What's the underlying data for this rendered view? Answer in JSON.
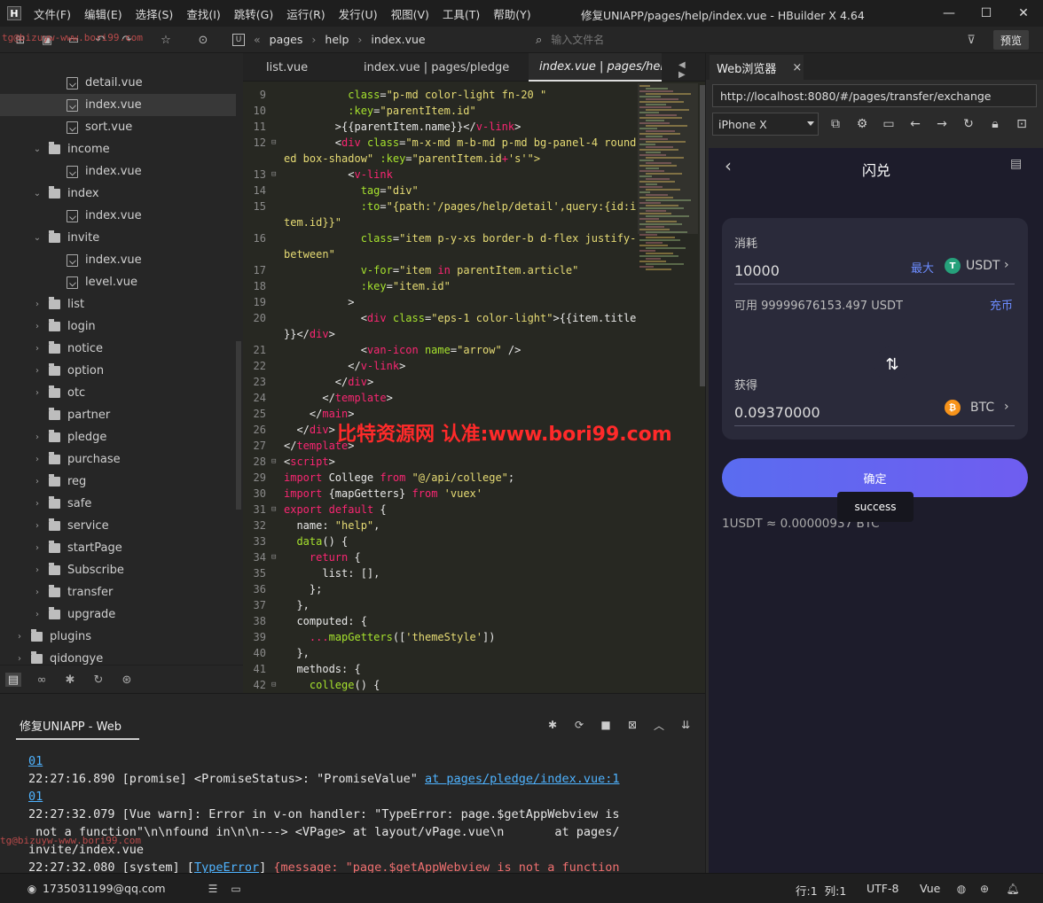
{
  "window": {
    "app_icon": "H",
    "title": "修复UNIAPP/pages/help/index.vue - HBuilder X 4.64",
    "menus": [
      "文件(F)",
      "编辑(E)",
      "选择(S)",
      "查找(I)",
      "跳转(G)",
      "运行(R)",
      "发行(U)",
      "视图(V)",
      "工具(T)",
      "帮助(Y)"
    ]
  },
  "toolbar": {
    "crumbs": [
      "pages",
      "help",
      "index.vue"
    ],
    "crumb_sep": "›",
    "file_search_placeholder": "输入文件名",
    "preview_label": "预览"
  },
  "watermarks": {
    "main": "比特资源网 认准:www.bori99.com",
    "small_top": "tg@bizuyw-www.bori99.com",
    "small_bottom": "tg@bizuyw-www.bori99.com"
  },
  "sidebar": {
    "items": [
      {
        "label": "detail.vue",
        "kind": "file",
        "depth": 3,
        "chevron": ""
      },
      {
        "label": "index.vue",
        "kind": "file",
        "depth": 3,
        "chevron": "",
        "selected": true
      },
      {
        "label": "sort.vue",
        "kind": "file",
        "depth": 3,
        "chevron": ""
      },
      {
        "label": "income",
        "kind": "folder",
        "depth": 2,
        "chevron": "⌄"
      },
      {
        "label": "index.vue",
        "kind": "file",
        "depth": 3,
        "chevron": ""
      },
      {
        "label": "index",
        "kind": "folder",
        "depth": 2,
        "chevron": "⌄"
      },
      {
        "label": "index.vue",
        "kind": "file",
        "depth": 3,
        "chevron": ""
      },
      {
        "label": "invite",
        "kind": "folder",
        "depth": 2,
        "chevron": "⌄"
      },
      {
        "label": "index.vue",
        "kind": "file",
        "depth": 3,
        "chevron": ""
      },
      {
        "label": "level.vue",
        "kind": "file",
        "depth": 3,
        "chevron": ""
      },
      {
        "label": "list",
        "kind": "folder",
        "depth": 2,
        "chevron": "›"
      },
      {
        "label": "login",
        "kind": "folder",
        "depth": 2,
        "chevron": "›"
      },
      {
        "label": "notice",
        "kind": "folder",
        "depth": 2,
        "chevron": "›"
      },
      {
        "label": "option",
        "kind": "folder",
        "depth": 2,
        "chevron": "›"
      },
      {
        "label": "otc",
        "kind": "folder",
        "depth": 2,
        "chevron": "›"
      },
      {
        "label": "partner",
        "kind": "folder",
        "depth": 2,
        "chevron": ""
      },
      {
        "label": "pledge",
        "kind": "folder",
        "depth": 2,
        "chevron": "›"
      },
      {
        "label": "purchase",
        "kind": "folder",
        "depth": 2,
        "chevron": "›"
      },
      {
        "label": "reg",
        "kind": "folder",
        "depth": 2,
        "chevron": "›"
      },
      {
        "label": "safe",
        "kind": "folder",
        "depth": 2,
        "chevron": "›"
      },
      {
        "label": "service",
        "kind": "folder",
        "depth": 2,
        "chevron": "›"
      },
      {
        "label": "startPage",
        "kind": "folder",
        "depth": 2,
        "chevron": "›"
      },
      {
        "label": "Subscribe",
        "kind": "folder",
        "depth": 2,
        "chevron": "›"
      },
      {
        "label": "transfer",
        "kind": "folder",
        "depth": 2,
        "chevron": "›"
      },
      {
        "label": "upgrade",
        "kind": "folder",
        "depth": 2,
        "chevron": "›"
      },
      {
        "label": "plugins",
        "kind": "folder",
        "depth": 1,
        "chevron": "›"
      },
      {
        "label": "qidongye",
        "kind": "folder",
        "depth": 1,
        "chevron": "›"
      }
    ]
  },
  "editor": {
    "tabs": [
      "list.vue",
      "index.vue | pages/pledge",
      "index.vue | pages/help"
    ],
    "tab_nav": "◀ ▶",
    "lines": [
      {
        "n": "9",
        "fold": "",
        "s": [
          [
            "          ",
            "p"
          ],
          [
            "class",
            "a"
          ],
          [
            "=",
            "p"
          ],
          [
            "\"p-md color-light fn-20 \"",
            "s"
          ]
        ]
      },
      {
        "n": "10",
        "fold": "",
        "s": [
          [
            "          ",
            "p"
          ],
          [
            ":key",
            "a"
          ],
          [
            "=",
            "p"
          ],
          [
            "\"parentItem.id\"",
            "s"
          ]
        ]
      },
      {
        "n": "11",
        "fold": "",
        "s": [
          [
            "        >{{parentItem.name}}</",
            "p"
          ],
          [
            "v-link",
            "t"
          ],
          [
            ">",
            "p"
          ]
        ]
      },
      {
        "n": "12",
        "fold": "⊟",
        "s": [
          [
            "        <",
            "p"
          ],
          [
            "div",
            "t"
          ],
          [
            " ",
            "p"
          ],
          [
            "class",
            "a"
          ],
          [
            "=",
            "p"
          ],
          [
            "\"m-x-md m-b-md p-md bg-panel-4 round",
            "s"
          ]
        ]
      },
      {
        "n": "",
        "fold": "",
        "s": [
          [
            "ed box-shadow\"",
            "s"
          ],
          [
            " ",
            "p"
          ],
          [
            ":key",
            "a"
          ],
          [
            "=",
            "p"
          ],
          [
            "\"parentItem.id",
            "s"
          ],
          [
            "+",
            "t"
          ],
          [
            "'s'",
            "s"
          ],
          [
            "\">",
            "s"
          ]
        ]
      },
      {
        "n": "13",
        "fold": "⊟",
        "s": [
          [
            "          <",
            "p"
          ],
          [
            "v-link",
            "t"
          ]
        ]
      },
      {
        "n": "14",
        "fold": "",
        "s": [
          [
            "            ",
            "p"
          ],
          [
            "tag",
            "a"
          ],
          [
            "=",
            "p"
          ],
          [
            "\"div\"",
            "s"
          ]
        ]
      },
      {
        "n": "15",
        "fold": "",
        "s": [
          [
            "            ",
            "p"
          ],
          [
            ":to",
            "a"
          ],
          [
            "=",
            "p"
          ],
          [
            "\"{path:'/pages/help/detail',query:{id:i",
            "s"
          ]
        ]
      },
      {
        "n": "",
        "fold": "",
        "s": [
          [
            "tem.id}}\"",
            "s"
          ]
        ]
      },
      {
        "n": "16",
        "fold": "",
        "s": [
          [
            "            ",
            "p"
          ],
          [
            "class",
            "a"
          ],
          [
            "=",
            "p"
          ],
          [
            "\"item p-y-xs border-b d-flex justify-",
            "s"
          ]
        ]
      },
      {
        "n": "",
        "fold": "",
        "s": [
          [
            "between\"",
            "s"
          ]
        ]
      },
      {
        "n": "17",
        "fold": "",
        "s": [
          [
            "            ",
            "p"
          ],
          [
            "v-for",
            "a"
          ],
          [
            "=",
            "p"
          ],
          [
            "\"item ",
            "s"
          ],
          [
            "in",
            "t"
          ],
          [
            " parentItem.article\"",
            "s"
          ]
        ]
      },
      {
        "n": "18",
        "fold": "",
        "s": [
          [
            "            ",
            "p"
          ],
          [
            ":key",
            "a"
          ],
          [
            "=",
            "p"
          ],
          [
            "\"item.id\"",
            "s"
          ]
        ]
      },
      {
        "n": "19",
        "fold": "",
        "s": [
          [
            "          >",
            "p"
          ]
        ]
      },
      {
        "n": "20",
        "fold": "",
        "s": [
          [
            "            <",
            "p"
          ],
          [
            "div",
            "t"
          ],
          [
            " ",
            "p"
          ],
          [
            "class",
            "a"
          ],
          [
            "=",
            "p"
          ],
          [
            "\"eps-1 color-light\"",
            "s"
          ],
          [
            ">{{item.title",
            "p"
          ]
        ]
      },
      {
        "n": "",
        "fold": "",
        "s": [
          [
            "}}</",
            "p"
          ],
          [
            "div",
            "t"
          ],
          [
            ">",
            "p"
          ]
        ]
      },
      {
        "n": "21",
        "fold": "",
        "s": [
          [
            "            <",
            "p"
          ],
          [
            "van-icon",
            "t"
          ],
          [
            " ",
            "p"
          ],
          [
            "name",
            "a"
          ],
          [
            "=",
            "p"
          ],
          [
            "\"arrow\"",
            "s"
          ],
          [
            " />",
            "p"
          ]
        ]
      },
      {
        "n": "22",
        "fold": "",
        "s": [
          [
            "          </",
            "p"
          ],
          [
            "v-link",
            "t"
          ],
          [
            ">",
            "p"
          ]
        ]
      },
      {
        "n": "23",
        "fold": "",
        "s": [
          [
            "        </",
            "p"
          ],
          [
            "div",
            "t"
          ],
          [
            ">",
            "p"
          ]
        ]
      },
      {
        "n": "24",
        "fold": "",
        "s": [
          [
            "      </",
            "p"
          ],
          [
            "template",
            "t"
          ],
          [
            ">",
            "p"
          ]
        ]
      },
      {
        "n": "25",
        "fold": "",
        "s": [
          [
            "    </",
            "p"
          ],
          [
            "main",
            "t"
          ],
          [
            ">",
            "p"
          ]
        ]
      },
      {
        "n": "26",
        "fold": "",
        "s": [
          [
            "  </",
            "p"
          ],
          [
            "div",
            "t"
          ],
          [
            ">",
            "p"
          ]
        ]
      },
      {
        "n": "27",
        "fold": "",
        "s": [
          [
            "</",
            "p"
          ],
          [
            "template",
            "t"
          ],
          [
            ">",
            "p"
          ]
        ]
      },
      {
        "n": "28",
        "fold": "⊟",
        "s": [
          [
            "<",
            "p"
          ],
          [
            "script",
            "t"
          ],
          [
            ">",
            "p"
          ]
        ]
      },
      {
        "n": "29",
        "fold": "",
        "s": [
          [
            "import",
            "t"
          ],
          [
            " College ",
            "p"
          ],
          [
            "from",
            "t"
          ],
          [
            " ",
            "p"
          ],
          [
            "\"@/api/college\"",
            "s"
          ],
          [
            ";",
            "p"
          ]
        ]
      },
      {
        "n": "30",
        "fold": "",
        "s": [
          [
            "import",
            "t"
          ],
          [
            " {mapGetters} ",
            "p"
          ],
          [
            "from",
            "t"
          ],
          [
            " ",
            "p"
          ],
          [
            "'vuex'",
            "s"
          ]
        ]
      },
      {
        "n": "31",
        "fold": "⊟",
        "s": [
          [
            "export",
            "t"
          ],
          [
            " ",
            "p"
          ],
          [
            "default",
            "t"
          ],
          [
            " {",
            "p"
          ]
        ]
      },
      {
        "n": "32",
        "fold": "",
        "s": [
          [
            "  name: ",
            "p"
          ],
          [
            "\"help\"",
            "s"
          ],
          [
            ",",
            "p"
          ]
        ]
      },
      {
        "n": "33",
        "fold": "",
        "s": [
          [
            "  ",
            "p"
          ],
          [
            "data",
            "a"
          ],
          [
            "() {",
            "p"
          ]
        ]
      },
      {
        "n": "34",
        "fold": "⊟",
        "s": [
          [
            "    ",
            "p"
          ],
          [
            "return",
            "t"
          ],
          [
            " {",
            "p"
          ]
        ]
      },
      {
        "n": "35",
        "fold": "",
        "s": [
          [
            "      list: [],",
            "p"
          ]
        ]
      },
      {
        "n": "36",
        "fold": "",
        "s": [
          [
            "    };",
            "p"
          ]
        ]
      },
      {
        "n": "37",
        "fold": "",
        "s": [
          [
            "  },",
            "p"
          ]
        ]
      },
      {
        "n": "38",
        "fold": "",
        "s": [
          [
            "  computed: {",
            "p"
          ]
        ]
      },
      {
        "n": "39",
        "fold": "",
        "s": [
          [
            "    ",
            "p"
          ],
          [
            "...",
            "t"
          ],
          [
            "mapGetters",
            "a"
          ],
          [
            "([",
            "p"
          ],
          [
            "'themeStyle'",
            "s"
          ],
          [
            "])",
            "p"
          ]
        ]
      },
      {
        "n": "40",
        "fold": "",
        "s": [
          [
            "  },",
            "p"
          ]
        ]
      },
      {
        "n": "41",
        "fold": "",
        "s": [
          [
            "  methods: {",
            "p"
          ]
        ]
      },
      {
        "n": "42",
        "fold": "⊟",
        "s": [
          [
            "    ",
            "p"
          ],
          [
            "college",
            "a"
          ],
          [
            "() {",
            "p"
          ]
        ]
      }
    ]
  },
  "browser": {
    "tab_label": "Web浏览器",
    "tab_close": "×",
    "url": "http://localhost:8080/#/pages/transfer/exchange",
    "device": "iPhone X",
    "page": {
      "back": "‹",
      "title": "闪兑",
      "spend_label": "消耗",
      "spend_amount": "10000",
      "max_label": "最大",
      "spend_coin": "USDT",
      "spend_coin_glyph": "T",
      "available": "可用 99999676153.497 USDT",
      "recharge_label": "充币",
      "swap_glyph": "⇅",
      "receive_label": "获得",
      "receive_amount": "0.09370000",
      "receive_coin": "BTC",
      "receive_coin_glyph": "₿",
      "confirm_label": "确定",
      "toast": "success",
      "rate": "1USDT ≈ 0.00000937 BTC"
    },
    "colors": {
      "accent": "#6c8cff",
      "usdt": "#26a17b",
      "btc": "#f7931a"
    }
  },
  "console": {
    "tab_label": "修复UNIAPP - Web",
    "lines": [
      [
        [
          "01",
          "lnk"
        ]
      ],
      [
        [
          "22:27:16.890 [promise] <PromiseStatus>: \"PromiseValue\" ",
          ""
        ],
        [
          "at pages/pledge/index.vue:1",
          "lnk"
        ]
      ],
      [
        [
          "01",
          "lnk"
        ]
      ],
      [
        [
          "22:27:32.079 [Vue warn]: Error in v-on handler: \"TypeError: page.$getAppWebview is",
          ""
        ]
      ],
      [
        [
          " not a function\"\\n\\nfound in\\n\\n---> <VPage> at layout/vPage.vue\\n       at pages/",
          ""
        ]
      ],
      [
        [
          "invite/index.vue",
          ""
        ]
      ],
      [
        [
          "22:27:32.080 [system] [",
          ""
        ],
        [
          "TypeError",
          "lnk"
        ],
        [
          "] ",
          ""
        ],
        [
          "{message: \"page.$getAppWebview is not a function",
          "err"
        ]
      ]
    ]
  },
  "statusbar": {
    "user": "1735031199@qq.com",
    "position": "行:1  列:1",
    "encoding": "UTF-8",
    "language": "Vue"
  }
}
